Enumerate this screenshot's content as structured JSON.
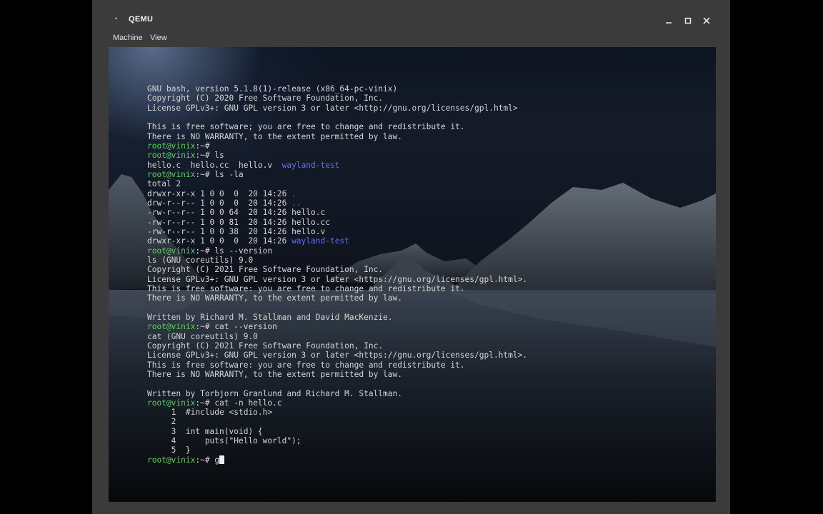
{
  "window": {
    "title": "QEMU",
    "title_glyph": "•",
    "controls": {
      "minimize": "–",
      "maximize": "□",
      "close": "✕"
    }
  },
  "menubar": {
    "items": [
      "Machine",
      "View"
    ]
  },
  "terminal": {
    "lines": [
      {
        "t": "GNU bash, version 5.1.8(1)-release (x86_64-pc-vinix)"
      },
      {
        "t": "Copyright (C) 2020 Free Software Foundation, Inc."
      },
      {
        "t": "License GPLv3+: GNU GPL version 3 or later <http://gnu.org/licenses/gpl.html>"
      },
      {
        "t": ""
      },
      {
        "t": "This is free software; you are free to change and redistribute it."
      },
      {
        "t": "There is NO WARRANTY, to the extent permitted by law."
      },
      {
        "p": "root@vinix",
        "s": ":~# ",
        "t": ""
      },
      {
        "p": "root@vinix",
        "s": ":~# ",
        "t": "ls"
      },
      {
        "t": "hello.c  hello.cc  hello.v  ",
        "d": "wayland-test"
      },
      {
        "p": "root@vinix",
        "s": ":~# ",
        "t": "ls -la"
      },
      {
        "t": "total 2"
      },
      {
        "t": "drwxr-xr-x 1 0 0  0  20 14:26 ",
        "d": "."
      },
      {
        "t": "drw-r--r-- 1 0 0  0  20 14:26 ",
        "d": ".."
      },
      {
        "t": "-rw-r--r-- 1 0 0 64  20 14:26 hello.c"
      },
      {
        "t": "-rw-r--r-- 1 0 0 81  20 14:26 hello.cc"
      },
      {
        "t": "-rw-r--r-- 1 0 0 38  20 14:26 hello.v"
      },
      {
        "t": "drwxr-xr-x 1 0 0  0  20 14:26 ",
        "d": "wayland-test"
      },
      {
        "p": "root@vinix",
        "s": ":~# ",
        "t": "ls --version"
      },
      {
        "t": "ls (GNU coreutils) 9.0"
      },
      {
        "t": "Copyright (C) 2021 Free Software Foundation, Inc."
      },
      {
        "t": "License GPLv3+: GNU GPL version 3 or later <https://gnu.org/licenses/gpl.html>."
      },
      {
        "t": "This is free software: you are free to change and redistribute it."
      },
      {
        "t": "There is NO WARRANTY, to the extent permitted by law."
      },
      {
        "t": ""
      },
      {
        "t": "Written by Richard M. Stallman and David MacKenzie."
      },
      {
        "p": "root@vinix",
        "s": ":~# ",
        "t": "cat --version"
      },
      {
        "t": "cat (GNU coreutils) 9.0"
      },
      {
        "t": "Copyright (C) 2021 Free Software Foundation, Inc."
      },
      {
        "t": "License GPLv3+: GNU GPL version 3 or later <https://gnu.org/licenses/gpl.html>."
      },
      {
        "t": "This is free software: you are free to change and redistribute it."
      },
      {
        "t": "There is NO WARRANTY, to the extent permitted by law."
      },
      {
        "t": ""
      },
      {
        "t": "Written by Torbjorn Granlund and Richard M. Stallman."
      },
      {
        "p": "root@vinix",
        "s": ":~# ",
        "t": "cat -n hello.c"
      },
      {
        "t": "     1  #include <stdio.h>"
      },
      {
        "t": "     2"
      },
      {
        "t": "     3  int main(void) {"
      },
      {
        "t": "     4      puts(\"Hello world\");"
      },
      {
        "t": "     5  }"
      },
      {
        "p": "root@vinix",
        "s": ":~# ",
        "t": "g",
        "cursor": true
      }
    ]
  },
  "colors": {
    "prompt": "#59d45a",
    "directory": "#5f6bff",
    "text": "#d4d4d4",
    "window_frame": "#3b3b3b"
  }
}
